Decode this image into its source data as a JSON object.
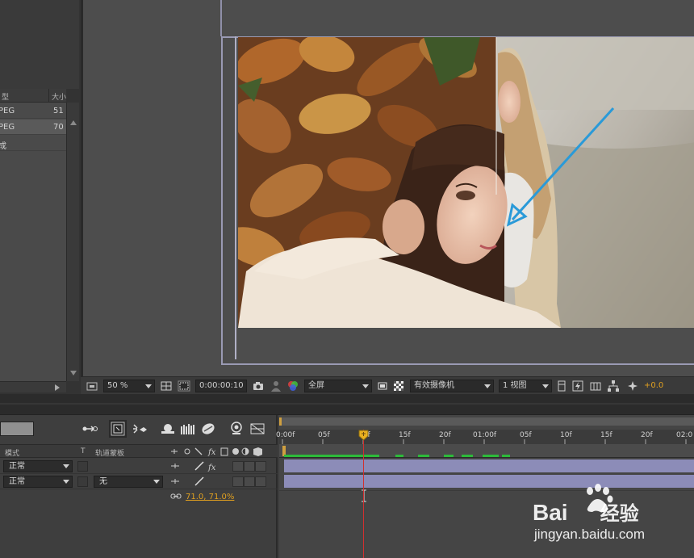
{
  "project": {
    "columns": {
      "type": "型",
      "size": "大小"
    },
    "rows": [
      {
        "type": "PEG",
        "size": "51",
        "selected": false
      },
      {
        "type": "PEG",
        "size": "70",
        "selected": true
      },
      {
        "type": "成",
        "size": "",
        "selected": false
      }
    ]
  },
  "viewer_toolbar": {
    "zoom": "50 %",
    "timecode": "0:00:00:10",
    "resolution": "全屏",
    "camera": "有效摄像机",
    "views": "1 视图",
    "exposure": "+0.0"
  },
  "timeline": {
    "columns": {
      "mode": "模式",
      "t": "T",
      "trackmat": "轨道蒙板"
    },
    "layers": [
      {
        "mode": "正常",
        "trackmat": ""
      },
      {
        "mode": "正常",
        "trackmat": "无"
      }
    ],
    "property_value": "71.0, 71.0%",
    "ruler_labels": [
      "0:00f",
      "05f",
      "10f",
      "15f",
      "20f",
      "01:00f",
      "05f",
      "10f",
      "15f",
      "20f",
      "02:0"
    ]
  },
  "watermark": {
    "brand": "Bai",
    "brand_cn": "经验",
    "url": "jingyan.baidu.com"
  },
  "colors": {
    "layer_bar": "#8c8cb8",
    "cti": "#d03030",
    "accent": "#e0a020"
  }
}
